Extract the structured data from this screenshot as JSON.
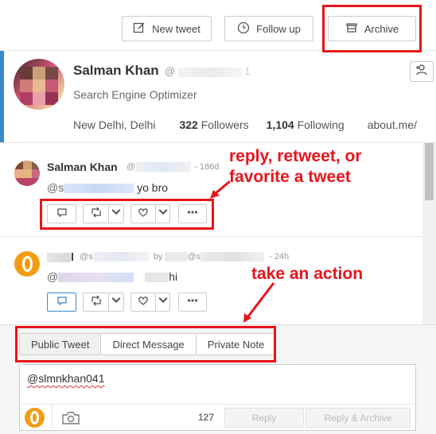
{
  "toolbar": {
    "new_tweet_label": "New tweet",
    "follow_up_label": "Follow up",
    "archive_label": "Archive"
  },
  "profile": {
    "name": "Salman Khan",
    "handle": "@",
    "handle_tail": "1",
    "bio": "Search Engine Optimizer",
    "location": "New Delhi, Delhi",
    "followers_count": "322",
    "followers_label": "Followers",
    "following_count": "1,104",
    "following_label": "Following",
    "link": "about.me/"
  },
  "tweets": [
    {
      "author": "Salman Khan",
      "handle_prefix": "@",
      "age": "- 186d",
      "mention_prefix": "@s",
      "text": "yo bro"
    },
    {
      "author": "l",
      "handle_prefix": "@s",
      "by_label": "by",
      "handle2_prefix": "@s",
      "age": "- 24h",
      "mention_prefix": "@",
      "text": "hi"
    }
  ],
  "composer": {
    "tabs": [
      "Public Tweet",
      "Direct Message",
      "Private Note"
    ],
    "active_tab": "Public Tweet",
    "text": "@slmnkhan041",
    "char_count": "127",
    "reply_label": "Reply",
    "reply_archive_label": "Reply & Archive"
  },
  "annotations": {
    "tweet_actions": "reply, retweet, or",
    "tweet_actions_2": "favorite a tweet",
    "composer_action": "take an action"
  },
  "colors": {
    "accent": "#3b88c3",
    "callout_red": "#e8141b",
    "avatar_orange": "#f39c12"
  }
}
